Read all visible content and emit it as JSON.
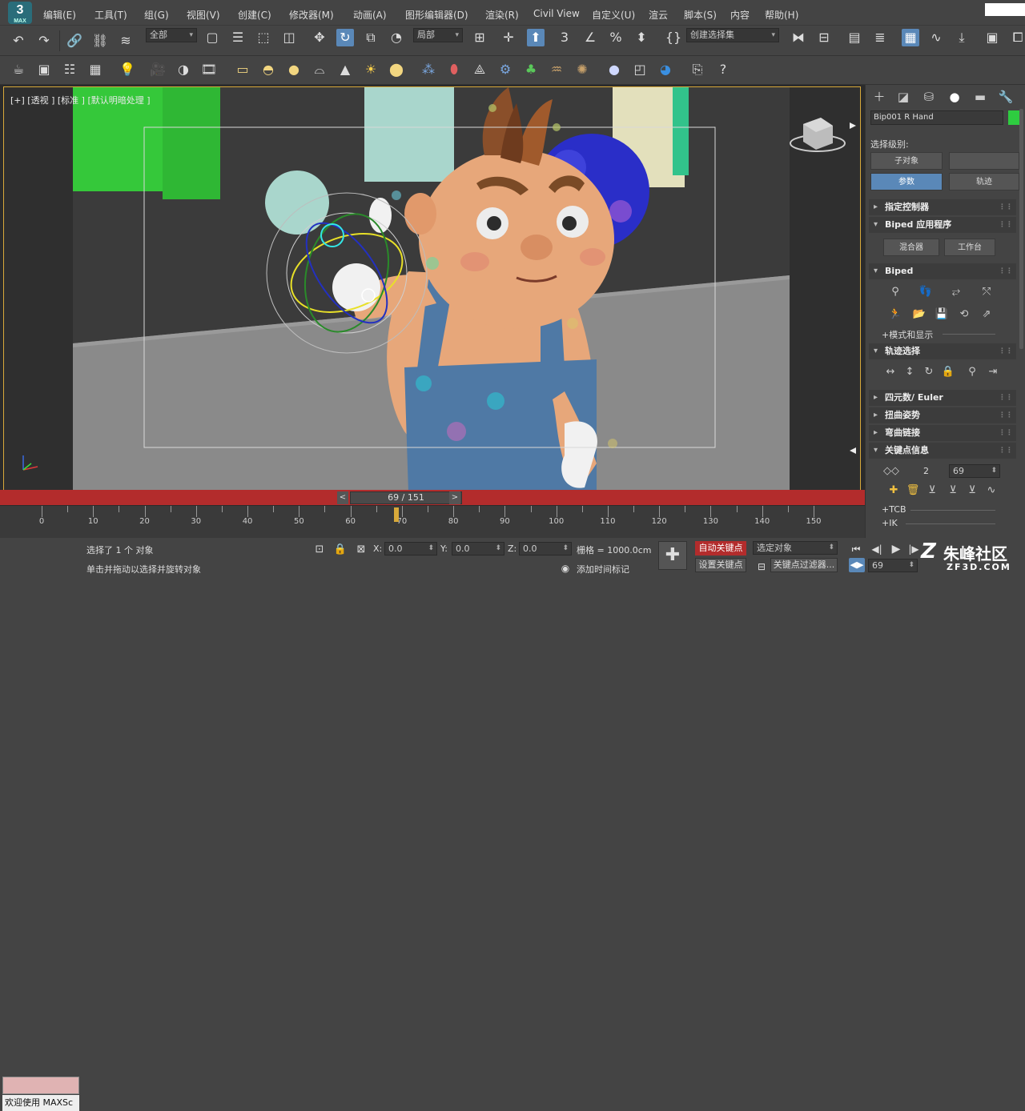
{
  "menu": [
    "编辑(E)",
    "工具(T)",
    "组(G)",
    "视图(V)",
    "创建(C)",
    "修改器(M)",
    "动画(A)",
    "图形编辑器(D)",
    "渲染(R)",
    "Civil View",
    "自定义(U)",
    "脚本(S)",
    "内容",
    "帮助(H)"
  ],
  "logo": {
    "main": "3",
    "sub": "MAX"
  },
  "extra_menu": "渲云",
  "toolbar": {
    "filter_select": "全部",
    "coord_select": "局部",
    "named_selection": "创建选择集"
  },
  "viewport": {
    "label": "[+] [透视 ] [标准 ] [默认明暗处理 ]",
    "frame_counter": "69 / 151",
    "prev": "<",
    "next": ">"
  },
  "timeline": {
    "ticks": [
      "0",
      "10",
      "20",
      "30",
      "40",
      "50",
      "60",
      "70",
      "80",
      "90",
      "100",
      "110",
      "120",
      "130",
      "140",
      "150"
    ],
    "current": 69,
    "max": 151
  },
  "status": {
    "welcome": "欢迎使用 MAXSc",
    "selected": "选择了 1 个 对象",
    "hint": "单击并拖动以选择并旋转对象",
    "x_label": "X:",
    "x_value": "0.0",
    "y_label": "Y:",
    "y_value": "0.0",
    "z_label": "Z:",
    "z_value": "0.0",
    "grid": "栅格 = 1000.0cm",
    "add_time_tag": "添加时间标记",
    "auto_key": "自动关键点",
    "set_key": "设置关键点",
    "selected_obj": "选定对象",
    "key_filter": "关键点过滤器...",
    "frame_value": "69"
  },
  "panel": {
    "object_name": "Bip001 R Hand",
    "object_color": "#2ecc40",
    "selection_level": "选择级别:",
    "sub_object": "子对象",
    "params": "参数",
    "track": "轨迹",
    "rollouts": {
      "assign_controller": "指定控制器",
      "biped_apps": "Biped 应用程序",
      "mixer": "混合器",
      "workbench": "工作台",
      "biped": "Biped",
      "mode_display": "+模式和显示",
      "track_selection": "轨迹选择",
      "quaternion": "四元数/ Euler",
      "twist_poses": "扭曲姿势",
      "bend_links": "弯曲链接",
      "key_info": "关键点信息",
      "key_number": "2",
      "key_frame": "69",
      "tcb": "+TCB",
      "ik": "+IK"
    }
  },
  "watermark": {
    "brand": "朱峰社区",
    "url": "ZF3D.COM"
  }
}
